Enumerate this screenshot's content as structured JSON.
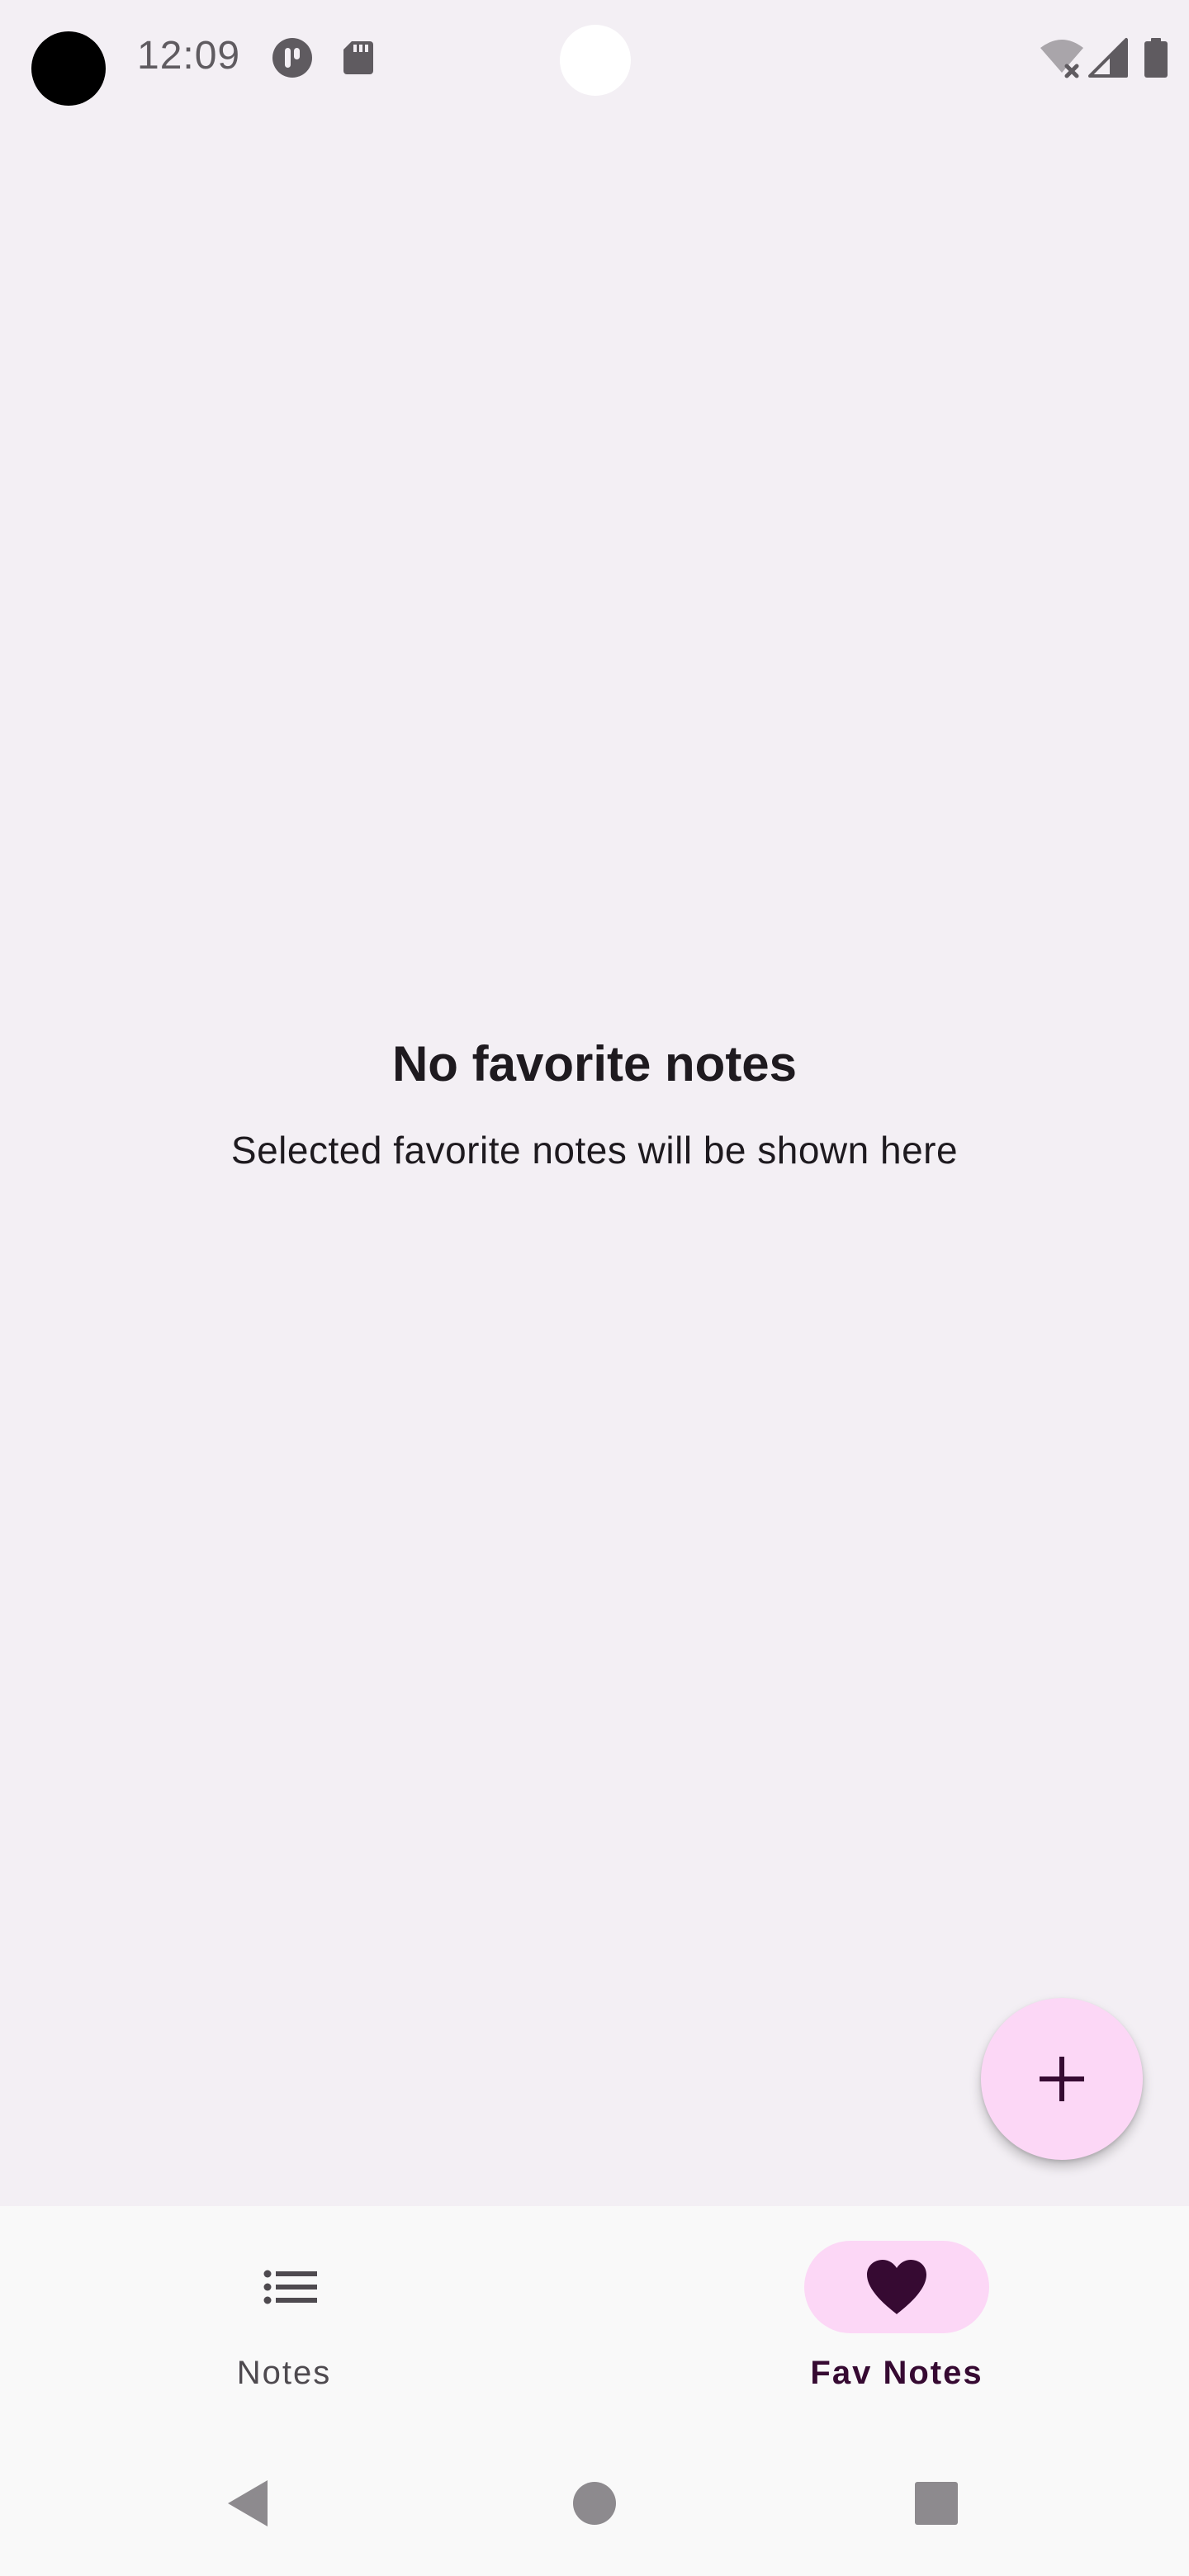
{
  "status_bar": {
    "time": "12:09"
  },
  "empty_state": {
    "title": "No favorite notes",
    "subtitle": "Selected favorite notes will be shown here"
  },
  "fab": {
    "icon": "plus-icon"
  },
  "bottom_nav": {
    "items": [
      {
        "label": "Notes",
        "icon": "list-icon",
        "selected": false
      },
      {
        "label": "Fav Notes",
        "icon": "heart-icon",
        "selected": true
      }
    ]
  },
  "system_nav": {
    "back_icon": "back-icon",
    "home_icon": "home-icon",
    "recents_icon": "recents-icon"
  },
  "colors": {
    "background": "#f3eff4",
    "accent_container": "#fcd7f6",
    "on_accent": "#360a32",
    "nav_bar": "#f9f9f9"
  }
}
